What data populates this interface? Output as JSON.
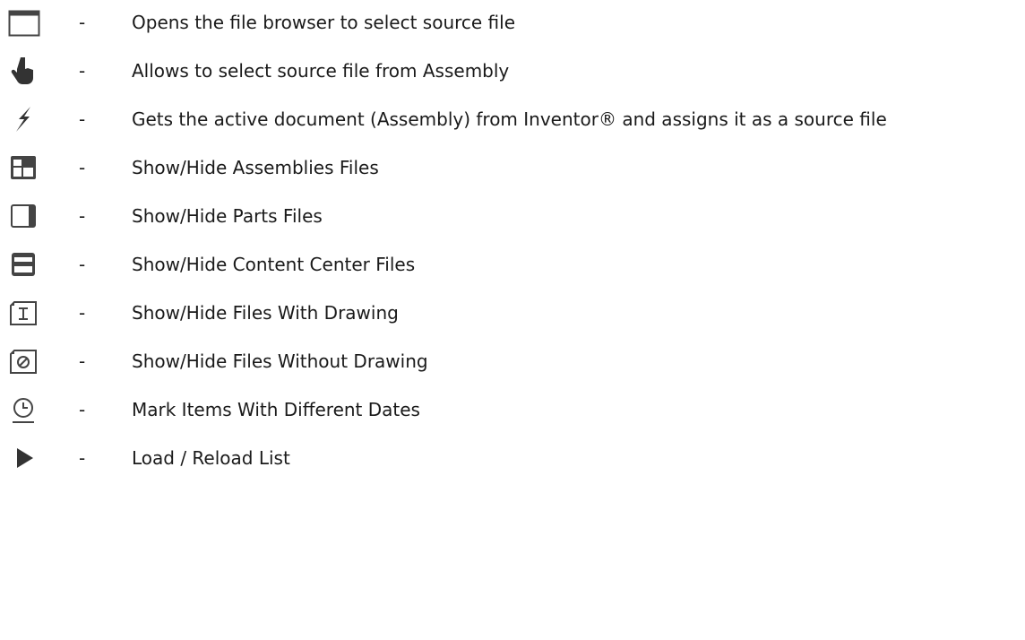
{
  "legend": {
    "separator": "-",
    "items": [
      {
        "icon": "folder-browse-icon",
        "text": "Opens the file browser to select source file"
      },
      {
        "icon": "pointer-hand-icon",
        "text": "Allows to select source file from Assembly"
      },
      {
        "icon": "lightning-bolt-icon",
        "text": "Gets the active document (Assembly) from Inventor® and assigns it as a source file"
      },
      {
        "icon": "assembly-file-icon",
        "text": "Show/Hide Assemblies Files"
      },
      {
        "icon": "part-file-icon",
        "text": "Show/Hide Parts Files"
      },
      {
        "icon": "content-center-icon",
        "text": "Show/Hide Content Center Files"
      },
      {
        "icon": "drawing-file-icon",
        "text": "Show/Hide Files With Drawing"
      },
      {
        "icon": "no-drawing-file-icon",
        "text": "Show/Hide Files Without Drawing"
      },
      {
        "icon": "clock-icon",
        "text": "Mark Items With Different Dates"
      },
      {
        "icon": "play-icon",
        "text": "Load / Reload List"
      }
    ]
  }
}
